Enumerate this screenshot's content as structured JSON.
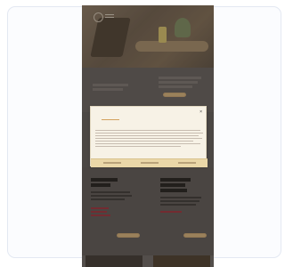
{
  "consent": {
    "tabs": [
      "",
      "",
      ""
    ],
    "close_label": "×",
    "title": "",
    "buttons": [
      "",
      "",
      ""
    ]
  },
  "colors": {
    "accent": "#d3a15d",
    "phone_bg": "#6a6461",
    "consent_bg": "#f7f2e6",
    "consent_bar": "#ead7a8"
  },
  "icons": [
    "logo-icon",
    "hamburger-menu-icon",
    "close-icon"
  ]
}
